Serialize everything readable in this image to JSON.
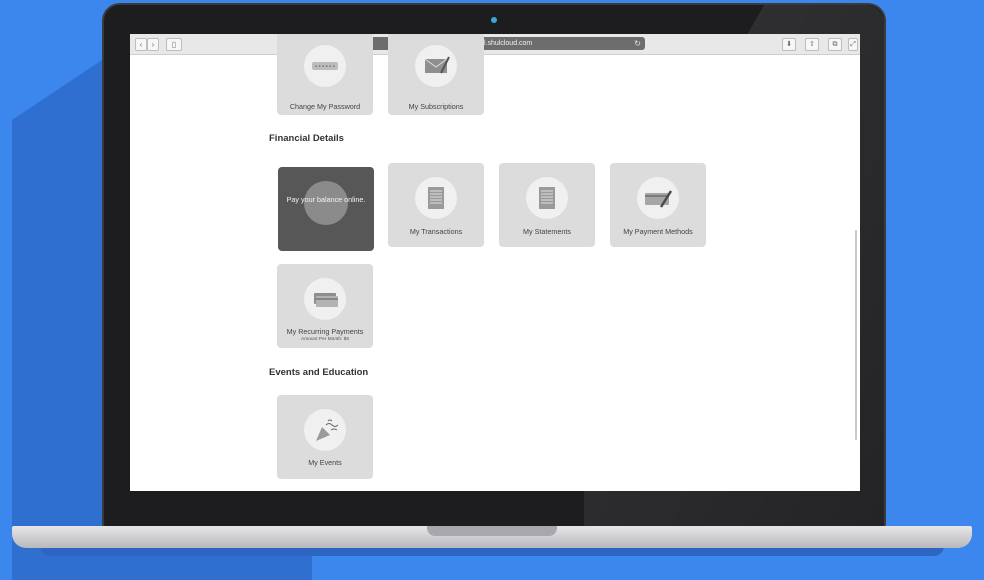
{
  "browser": {
    "url": "labshul.shulcloud.com",
    "reload_icon": "reload-icon",
    "back_icon": "back-icon",
    "forward_icon": "forward-icon",
    "sidebar_icon": "sidebar-icon",
    "toolbar_icons": [
      "download-icon",
      "share-icon",
      "tabs-icon"
    ]
  },
  "page": {
    "top_tiles": [
      {
        "label": "Change My Password",
        "icon": "password-icon"
      },
      {
        "label": "My Subscriptions",
        "icon": "envelope-icon"
      }
    ],
    "financial_section": {
      "title": "Financial Details",
      "pay_tile_label": "Pay your balance online.",
      "tiles": [
        {
          "label": "My Transactions",
          "icon": "document-icon"
        },
        {
          "label": "My Statements",
          "icon": "document-icon"
        },
        {
          "label": "My Payment Methods",
          "icon": "card-pen-icon"
        }
      ],
      "recurring": {
        "label": "My Recurring Payments",
        "sub": "Amount Per Month: $6",
        "icon": "cards-icon"
      }
    },
    "events_section": {
      "title": "Events and Education",
      "tile": {
        "label": "My Events",
        "icon": "party-popper-icon"
      }
    }
  },
  "colors": {
    "background": "#3b87ee",
    "tile": "#dcdcdc",
    "pay_tile": "#575757"
  }
}
